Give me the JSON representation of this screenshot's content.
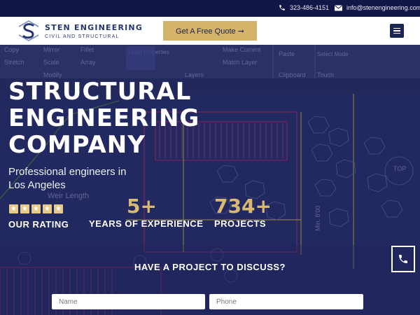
{
  "topbar": {
    "phone": "323-486-4151",
    "email": "info@stenengineering.com",
    "phone_icon": "phone-icon",
    "mail_icon": "mail-icon"
  },
  "header": {
    "logo_name": "STEN ENGINEERING",
    "logo_tagline": "CIVIL AND STRUCTURAL",
    "quote_label": "Get A Free Quote ➞",
    "menu_icon": "hamburger-menu-icon"
  },
  "hero": {
    "title_lines": [
      "STRUCTURAL",
      "ENGINEERING",
      "COMPANY"
    ],
    "subtitle": "Professional engineers in Los Angeles",
    "rating": {
      "stars": 5,
      "label": "OUR RATING"
    },
    "years": {
      "value": "5+",
      "label": "YEARS OF EXPERIENCE"
    },
    "projects": {
      "value": "734+",
      "label": "PROJECTS"
    },
    "background_text": {
      "ribbon": [
        "Copy",
        "Mirror",
        "Fillet",
        "Layer Properties",
        "Make Current",
        "Paste",
        "Select Mode",
        "Stretch",
        "Scale",
        "Array",
        "Match Layer",
        "Modify",
        "Layers",
        "Clipboard",
        "Touch"
      ],
      "drawing": [
        "Weir Length",
        "TOP",
        "Min. 8'00"
      ]
    }
  },
  "form": {
    "heading": "HAVE A PROJECT TO DISCUSS?",
    "name_placeholder": "Name",
    "phone_placeholder": "Phone"
  },
  "colors": {
    "navy": "#121747",
    "gold": "#d4b36b",
    "accent_gold_text": "#d9b971"
  }
}
